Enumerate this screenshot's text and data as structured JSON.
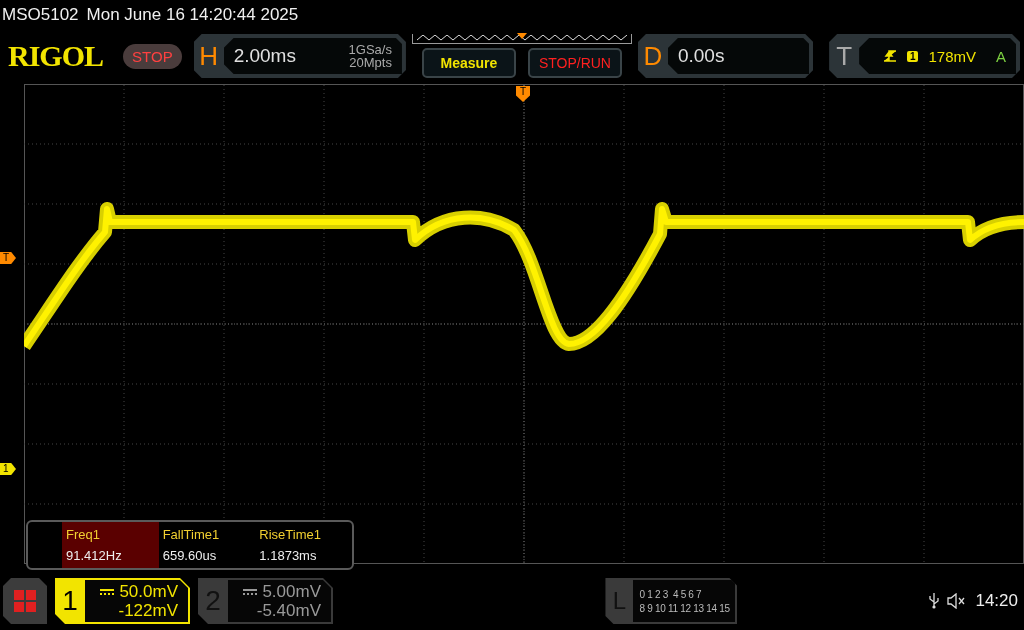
{
  "header": {
    "model": "MSO5102",
    "datetime": "Mon June 16 14:20:44 2025"
  },
  "toolbar": {
    "logo": "RIGOL",
    "run_state": "STOP",
    "horizontal": {
      "label": "H",
      "timebase": "2.00ms",
      "sample_rate": "1GSa/s",
      "memory_depth": "20Mpts"
    },
    "buttons": [
      {
        "label": "Measure",
        "kind": "measure"
      },
      {
        "label": "STOP/RUN",
        "kind": "run"
      }
    ],
    "delay": {
      "label": "D",
      "value": "0.00s"
    },
    "trigger": {
      "label": "T",
      "source": "1",
      "level": "178mV",
      "mode": "A"
    }
  },
  "scope": {
    "top_marker": "T",
    "markers": [
      {
        "label": "T",
        "kind": "trigger"
      },
      {
        "label": "1",
        "kind": "channel"
      }
    ]
  },
  "measurements": [
    {
      "name": "Freq1",
      "value": "91.412Hz",
      "selected": true
    },
    {
      "name": "FallTime1",
      "value": "659.60us",
      "selected": false
    },
    {
      "name": "RiseTime1",
      "value": "1.1873ms",
      "selected": false
    }
  ],
  "channels": [
    {
      "number": "1",
      "scale": "50.0mV",
      "offset": "-122mV",
      "selected": true
    },
    {
      "number": "2",
      "scale": "5.00mV",
      "offset": "-5.40mV",
      "selected": false
    }
  ],
  "logic": {
    "label": "L",
    "rows": [
      "0 1 2 3  4 5 6 7",
      "8 9 10 11 12 13 14 15"
    ]
  },
  "status": {
    "time": "14:20"
  }
}
